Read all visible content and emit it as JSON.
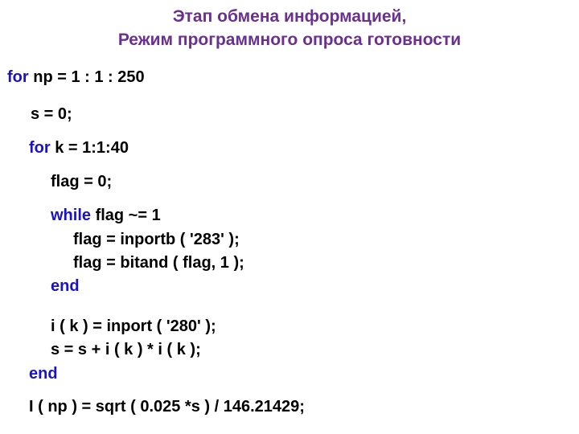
{
  "title": {
    "line1": "Этап обмена информацией,",
    "line2": "Режим программного опроса готовности"
  },
  "colors": {
    "title": "#6a2f8f",
    "keyword": "#1a12c8",
    "code": "#000000"
  },
  "code": [
    {
      "kw": "for",
      "rest": " np = 1 : 1 : 250"
    },
    {
      "kw": "",
      "rest": "s = 0;"
    },
    {
      "kw": "for",
      "rest": " k = 1:1:40"
    },
    {
      "kw": "",
      "rest": "flag = 0;"
    },
    {
      "kw": "while",
      "rest": " flag ~= 1"
    },
    {
      "kw": "",
      "rest": "flag = inportb ( '283' );"
    },
    {
      "kw": "",
      "rest": "flag = bitand ( flag, 1 );"
    },
    {
      "kw": "end",
      "rest": ""
    },
    {
      "kw": "",
      "rest": "i ( k ) = inport ( '280' );"
    },
    {
      "kw": "",
      "rest": "s = s + i ( k ) * i ( k );"
    },
    {
      "kw": "end",
      "rest": ""
    },
    {
      "kw": "",
      "rest": "I ( np ) = sqrt ( 0.025 *s ) / 146.21429;"
    }
  ]
}
